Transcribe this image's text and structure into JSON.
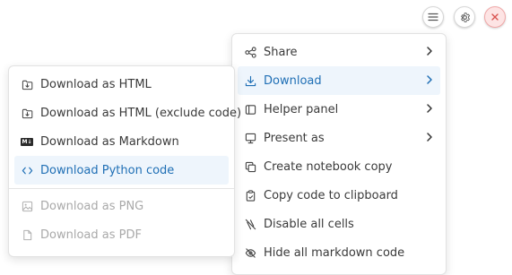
{
  "toolbar": {
    "menu_icon": "hamburger-icon",
    "settings_icon": "gear-icon",
    "close_icon": "close-icon"
  },
  "main_menu": {
    "items": [
      {
        "label": "Share",
        "icon": "share-icon",
        "has_submenu": true
      },
      {
        "label": "Download",
        "icon": "download-icon",
        "has_submenu": true,
        "active": true
      },
      {
        "label": "Helper panel",
        "icon": "panel-icon",
        "has_submenu": true
      },
      {
        "label": "Present as",
        "icon": "presentation-icon",
        "has_submenu": true
      },
      {
        "label": "Create notebook copy",
        "icon": "copy-icon"
      },
      {
        "label": "Copy code to clipboard",
        "icon": "clipboard-icon"
      },
      {
        "label": "Disable all cells",
        "icon": "disable-icon"
      },
      {
        "label": "Hide all markdown code",
        "icon": "eye-off-icon"
      }
    ]
  },
  "download_menu": {
    "items": [
      {
        "label": "Download as HTML",
        "icon": "file-download-icon"
      },
      {
        "label": "Download as HTML (exclude code)",
        "icon": "file-download-icon"
      },
      {
        "label": "Download as Markdown",
        "icon": "markdown-icon",
        "badge": "M↓"
      },
      {
        "label": "Download Python code",
        "icon": "code-icon",
        "active": true
      },
      {
        "label": "Download as PNG",
        "icon": "image-icon",
        "disabled": true
      },
      {
        "label": "Download as PDF",
        "icon": "file-icon",
        "disabled": true
      }
    ]
  },
  "colors": {
    "accent": "#1f6fb5",
    "active_bg": "#eef5fc",
    "disabled_text": "#a9a9a9",
    "close_bg": "#fde4e4"
  }
}
